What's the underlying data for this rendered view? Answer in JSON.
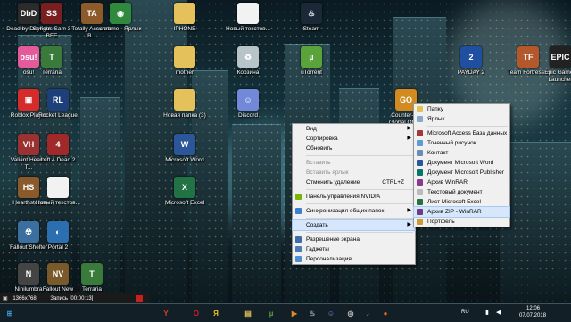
{
  "desktop_icons": [
    {
      "id": "dbd",
      "label": "Dead by Daylight",
      "icon": "dbd-icon",
      "color": "#2b2b2b",
      "glyph": "DbD"
    },
    {
      "id": "ss3",
      "label": "Serious Sam 3 BFE",
      "icon": "serious-sam-icon",
      "color": "#7a1f1f",
      "glyph": "SS"
    },
    {
      "id": "tam",
      "label": "Totally Accurate B...",
      "icon": "tabs-icon",
      "color": "#8d5a2a",
      "glyph": "TA"
    },
    {
      "id": "chrome",
      "label": "chrome - Ярлык",
      "icon": "chrome-icon",
      "color": "#2f8a3e",
      "glyph": "◉"
    },
    {
      "id": "iphone",
      "label": "IPHONE",
      "icon": "folder-icon",
      "color": "#e4c15a",
      "glyph": ""
    },
    {
      "id": "newtxt",
      "label": "Новый текстов...",
      "icon": "text-file-icon",
      "color": "#f2f2f2",
      "glyph": ""
    },
    {
      "id": "steam",
      "label": "Steam",
      "icon": "steam-icon",
      "color": "#1b2838",
      "glyph": "♨"
    },
    {
      "id": "osu",
      "label": "osu!",
      "icon": "osu-icon",
      "color": "#e35b9a",
      "glyph": "osu!"
    },
    {
      "id": "terraria",
      "label": "Terraria",
      "icon": "terraria-icon",
      "color": "#3a7a3a",
      "glyph": "T"
    },
    {
      "id": "mother",
      "label": "mother",
      "icon": "folder-icon",
      "color": "#e4c15a",
      "glyph": ""
    },
    {
      "id": "trash",
      "label": "Корзина",
      "icon": "recycle-bin-icon",
      "color": "#b7c4c9",
      "glyph": "♻"
    },
    {
      "id": "utorrent",
      "label": "uTorrent",
      "icon": "utorrent-icon",
      "color": "#59a33a",
      "glyph": "µ"
    },
    {
      "id": "payday",
      "label": "PAYDAY 2",
      "icon": "payday-icon",
      "color": "#1f4fa0",
      "glyph": "2"
    },
    {
      "id": "tf2",
      "label": "Team Fortress 2",
      "icon": "tf2-icon",
      "color": "#b4572b",
      "glyph": "TF"
    },
    {
      "id": "epic",
      "label": "Epic Games Launcher",
      "icon": "epic-icon",
      "color": "#222",
      "glyph": "EPIC"
    },
    {
      "id": "roblox",
      "label": "Roblox Player",
      "icon": "roblox-icon",
      "color": "#d62b2b",
      "glyph": "▣"
    },
    {
      "id": "rocket",
      "label": "Rocket League",
      "icon": "rocket-league-icon",
      "color": "#1d3f7a",
      "glyph": "RL"
    },
    {
      "id": "newfolder",
      "label": "Новая папка (3)",
      "icon": "folder-icon",
      "color": "#e4c15a",
      "glyph": ""
    },
    {
      "id": "discord",
      "label": "Discord",
      "icon": "discord-icon",
      "color": "#7289da",
      "glyph": "☺"
    },
    {
      "id": "csgo",
      "label": "Counter-Str Global Offe...",
      "icon": "csgo-icon",
      "color": "#d18b1e",
      "glyph": "GO"
    },
    {
      "id": "valiant",
      "label": "Valiant Hearts T...",
      "icon": "valiant-icon",
      "color": "#9b3232",
      "glyph": "VH"
    },
    {
      "id": "l4d2",
      "label": "Left 4 Dead 2",
      "icon": "l4d2-icon",
      "color": "#a02a2a",
      "glyph": "4"
    },
    {
      "id": "msword",
      "label": "Microsoft Word",
      "icon": "word-icon",
      "color": "#2b579a",
      "glyph": "W"
    },
    {
      "id": "hearth",
      "label": "Hearthstone",
      "icon": "hearthstone-icon",
      "color": "#8a5a2a",
      "glyph": "HS"
    },
    {
      "id": "newtxt2",
      "label": "Новый текстов...",
      "icon": "text-file-icon",
      "color": "#f2f2f2",
      "glyph": ""
    },
    {
      "id": "msexcel",
      "label": "Microsoft Excel",
      "icon": "excel-icon",
      "color": "#217346",
      "glyph": "X"
    },
    {
      "id": "fallout",
      "label": "Fallout Shelter",
      "icon": "fallout-shelter-icon",
      "color": "#3a6fa0",
      "glyph": "☢"
    },
    {
      "id": "portal2",
      "label": "Portal 2",
      "icon": "portal-icon",
      "color": "#2b6fb0",
      "glyph": "◐"
    },
    {
      "id": "nihilumbra",
      "label": "Nihilumbra",
      "icon": "nihilumbra-icon",
      "color": "#444",
      "glyph": "N"
    },
    {
      "id": "fnv",
      "label": "Fallout New Vegas",
      "icon": "fallout-nv-icon",
      "color": "#7a5a2a",
      "glyph": "NV"
    },
    {
      "id": "terraria2",
      "label": "Terraria",
      "icon": "terraria-icon",
      "color": "#3a7a3a",
      "glyph": "T"
    }
  ],
  "context_menu": {
    "items": [
      {
        "label": "Вид",
        "arrow": true
      },
      {
        "label": "Сортировка",
        "arrow": true
      },
      {
        "label": "Обновить"
      },
      {
        "sep": true
      },
      {
        "label": "Вставить",
        "disabled": true
      },
      {
        "label": "Вставить ярлык",
        "disabled": true
      },
      {
        "label": "Отменить удаление",
        "shortcut": "CTRL+Z"
      },
      {
        "sep": true
      },
      {
        "label": "Панель управления NVIDIA",
        "icon": "nvidia-icon",
        "icolor": "#76b900"
      },
      {
        "sep": true
      },
      {
        "label": "Синхронизация общих папок",
        "icon": "sync-icon",
        "icolor": "#3a7fd0",
        "arrow": true
      },
      {
        "sep": true
      },
      {
        "label": "Создать",
        "arrow": true,
        "highlight": true
      },
      {
        "sep": true
      },
      {
        "label": "Разрешение экрана",
        "icon": "display-icon",
        "icolor": "#3c6ea8"
      },
      {
        "label": "Гаджеты",
        "icon": "gadgets-icon",
        "icolor": "#4d7cb5"
      },
      {
        "label": "Персонализация",
        "icon": "personalize-icon",
        "icolor": "#4d8fd0"
      }
    ]
  },
  "submenu": {
    "items": [
      {
        "label": "Папку",
        "icon": "folder-icon",
        "icolor": "#e4c15a"
      },
      {
        "label": "Ярлык",
        "icon": "shortcut-icon",
        "icolor": "#8aa6c8"
      },
      {
        "sep": true
      },
      {
        "label": "Microsoft Access База данных",
        "icon": "access-icon",
        "icolor": "#a4373a"
      },
      {
        "label": "Точечный рисунок",
        "icon": "bitmap-icon",
        "icolor": "#5d9bd5"
      },
      {
        "label": "Контакт",
        "icon": "contact-icon",
        "icolor": "#6a8db5"
      },
      {
        "label": "Документ Microsoft Word",
        "icon": "word-icon",
        "icolor": "#2b579a"
      },
      {
        "label": "Документ Microsoft Publisher",
        "icon": "publisher-icon",
        "icolor": "#077568"
      },
      {
        "label": "Архив WinRAR",
        "icon": "winrar-icon",
        "icolor": "#8a3a8a"
      },
      {
        "label": "Текстовый документ",
        "icon": "text-file-icon",
        "icolor": "#bbbbbb"
      },
      {
        "label": "Лист Microsoft Excel",
        "icon": "excel-icon",
        "icolor": "#217346"
      },
      {
        "label": "Архив ZIP - WinRAR",
        "icon": "winrar-zip-icon",
        "icolor": "#6b3a8a",
        "highlight": true
      },
      {
        "label": "Портфель",
        "icon": "briefcase-icon",
        "icolor": "#c79a3a"
      }
    ]
  },
  "recorder": {
    "resolution": "1366x768",
    "status": "Запись [00:00:13]"
  },
  "taskbar": {
    "apps": [
      {
        "name": "windows-start-icon",
        "glyph": "⊞",
        "color": "#3aa0e0"
      },
      {
        "name": "yandex-browser-icon",
        "glyph": "Y",
        "color": "#e03a2a"
      },
      {
        "name": "opera-icon",
        "glyph": "O",
        "color": "#d01a2a"
      },
      {
        "name": "yandex-icon",
        "glyph": "Я",
        "color": "#f0c020"
      },
      {
        "name": "explorer-icon",
        "glyph": "▤",
        "color": "#e4c15a"
      },
      {
        "name": "utorrent-icon",
        "glyph": "µ",
        "color": "#59a33a"
      },
      {
        "name": "media-icon",
        "glyph": "▶",
        "color": "#e08a2a"
      },
      {
        "name": "steam-icon",
        "glyph": "♨",
        "color": "#9ab"
      },
      {
        "name": "discord-icon",
        "glyph": "☺",
        "color": "#7289da"
      },
      {
        "name": "obs-icon",
        "glyph": "◎",
        "color": "#ccc"
      },
      {
        "name": "music-icon",
        "glyph": "♪",
        "color": "#d04a8a"
      },
      {
        "name": "firefox-icon",
        "glyph": "●",
        "color": "#e06a2a"
      }
    ],
    "lang": "RU",
    "time": "12:06",
    "date": "07.07.2018"
  }
}
